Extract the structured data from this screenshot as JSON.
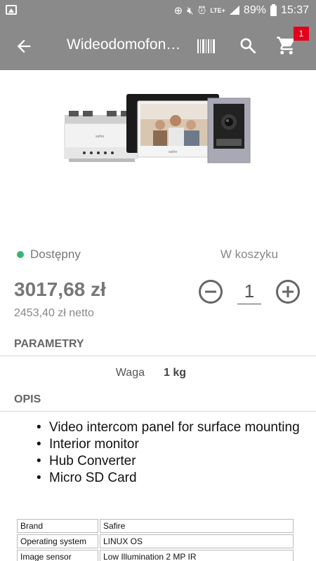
{
  "status_bar": {
    "battery": "89%",
    "time": "15:37",
    "network": "LTE+"
  },
  "app_bar": {
    "title": "Wideodomofon…",
    "cart_count": "1"
  },
  "product": {
    "availability": "Dostępny",
    "in_cart_label": "W koszyku",
    "price": "3017,68 zł",
    "net_price": "2453,40 zł netto",
    "quantity": "1",
    "image_brand_text": "safire"
  },
  "parameters": {
    "heading": "PARAMETRY",
    "rows": [
      {
        "label": "Waga",
        "value": "1 kg"
      }
    ]
  },
  "description": {
    "heading": "OPIS",
    "items": [
      "Video intercom panel for surface mounting",
      "Interior monitor",
      "Hub Converter",
      "Micro SD Card"
    ],
    "spec_table": [
      {
        "key": "Brand",
        "value": "Safire"
      },
      {
        "key": "Operating system",
        "value": "LINUX OS"
      },
      {
        "key": "Image sensor",
        "value": "Low Illumination 2 MP IR"
      }
    ]
  },
  "colors": {
    "app_bar": "#8a8a8a",
    "badge": "#e2001a",
    "available": "#3bb273"
  }
}
